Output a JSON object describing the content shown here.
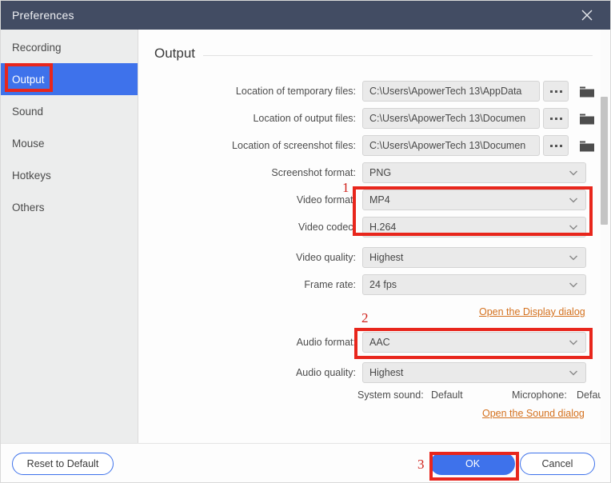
{
  "window": {
    "title": "Preferences",
    "close_icon": "close-icon"
  },
  "sidebar": {
    "items": [
      {
        "label": "Recording",
        "selected": false
      },
      {
        "label": "Output",
        "selected": true
      },
      {
        "label": "Sound",
        "selected": false
      },
      {
        "label": "Mouse",
        "selected": false
      },
      {
        "label": "Hotkeys",
        "selected": false
      },
      {
        "label": "Others",
        "selected": false
      }
    ]
  },
  "content": {
    "section_title": "Output",
    "paths": [
      {
        "label": "Location of temporary files:",
        "value": "C:\\Users\\ApowerTech 13\\AppData",
        "browse_label": "browse-icon",
        "folder_label": "folder-icon"
      },
      {
        "label": "Location of output files:",
        "value": "C:\\Users\\ApowerTech 13\\Documen",
        "browse_label": "browse-icon",
        "folder_label": "folder-icon"
      },
      {
        "label": "Location of screenshot files:",
        "value": "C:\\Users\\ApowerTech 13\\Documen",
        "browse_label": "browse-icon",
        "folder_label": "folder-icon"
      }
    ],
    "selects": [
      {
        "label": "Screenshot format:",
        "value": "PNG"
      },
      {
        "label": "Video format:",
        "value": "MP4"
      },
      {
        "label": "Video codec:",
        "value": "H.264"
      },
      {
        "label": "Video quality:",
        "value": "Highest"
      },
      {
        "label": "Frame rate:",
        "value": "24 fps"
      },
      {
        "label": "Audio format:",
        "value": "AAC"
      },
      {
        "label": "Audio quality:",
        "value": "Highest"
      }
    ],
    "display_link": "Open the Display dialog",
    "sound_link": "Open the Sound dialog",
    "system_sound_label": "System sound:",
    "system_sound_value": "Default",
    "microphone_label": "Microphone:",
    "microphone_value": "Default"
  },
  "footer": {
    "reset_label": "Reset to Default",
    "ok_label": "OK",
    "cancel_label": "Cancel"
  },
  "annotations": {
    "step1": "1",
    "step2": "2",
    "step3": "3",
    "highlight_color": "#e8261c"
  }
}
